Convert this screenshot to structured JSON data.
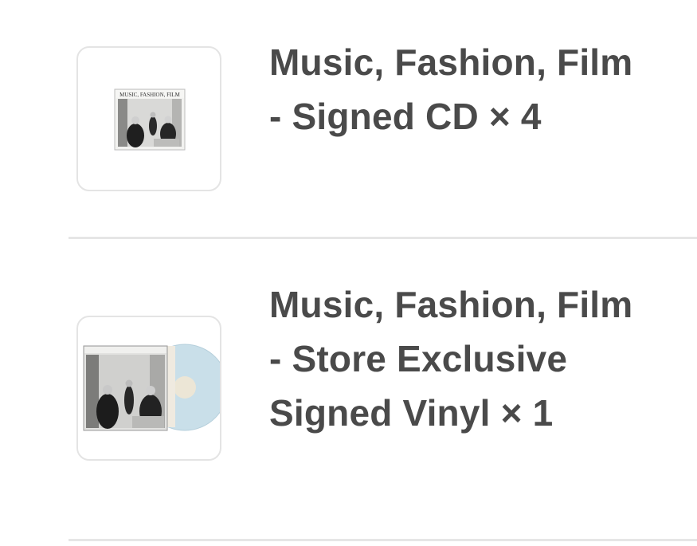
{
  "items": [
    {
      "title": "Music, Fashion, Film - Signed CD × 4",
      "format": "CD",
      "quantity": 4,
      "thumbnail": {
        "kind": "cd-cover",
        "cover_text": "MUSIC, FASHION, FILM"
      }
    },
    {
      "title": "Music, Fashion, Film - Store Exclusive Signed Vinyl × 1",
      "format": "Vinyl",
      "quantity": 1,
      "thumbnail": {
        "kind": "vinyl-record",
        "disc_color": "#c9dfe9"
      }
    }
  ]
}
